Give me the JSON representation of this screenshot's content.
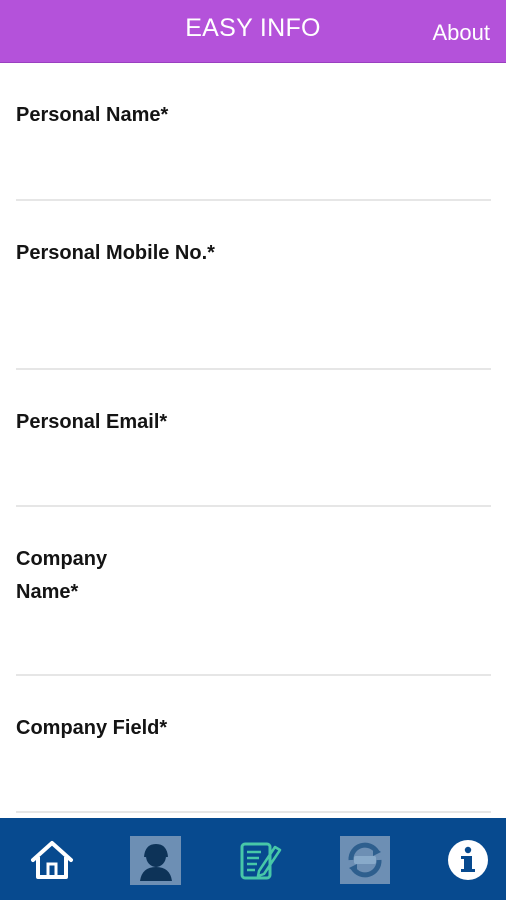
{
  "header": {
    "title": "EASY INFO",
    "about_label": "About"
  },
  "form": {
    "fields": [
      {
        "label": "Personal Name*",
        "value": "",
        "placeholder": ""
      },
      {
        "label": "Personal Mobile No.*",
        "value": "",
        "placeholder": ""
      },
      {
        "label": "Personal Email*",
        "value": "",
        "placeholder": ""
      },
      {
        "label": "Company Name*",
        "value": "",
        "placeholder": ""
      },
      {
        "label": "Company Field*",
        "value": "",
        "placeholder": ""
      }
    ]
  },
  "tabbar": {
    "items": [
      {
        "icon": "home-icon"
      },
      {
        "icon": "person-icon"
      },
      {
        "icon": "edit-note-icon"
      },
      {
        "icon": "refresh-badge-icon"
      },
      {
        "icon": "info-icon"
      }
    ]
  },
  "colors": {
    "header": "#b452da",
    "tabbar": "#074a8f",
    "divider": "#e6e6e6"
  }
}
